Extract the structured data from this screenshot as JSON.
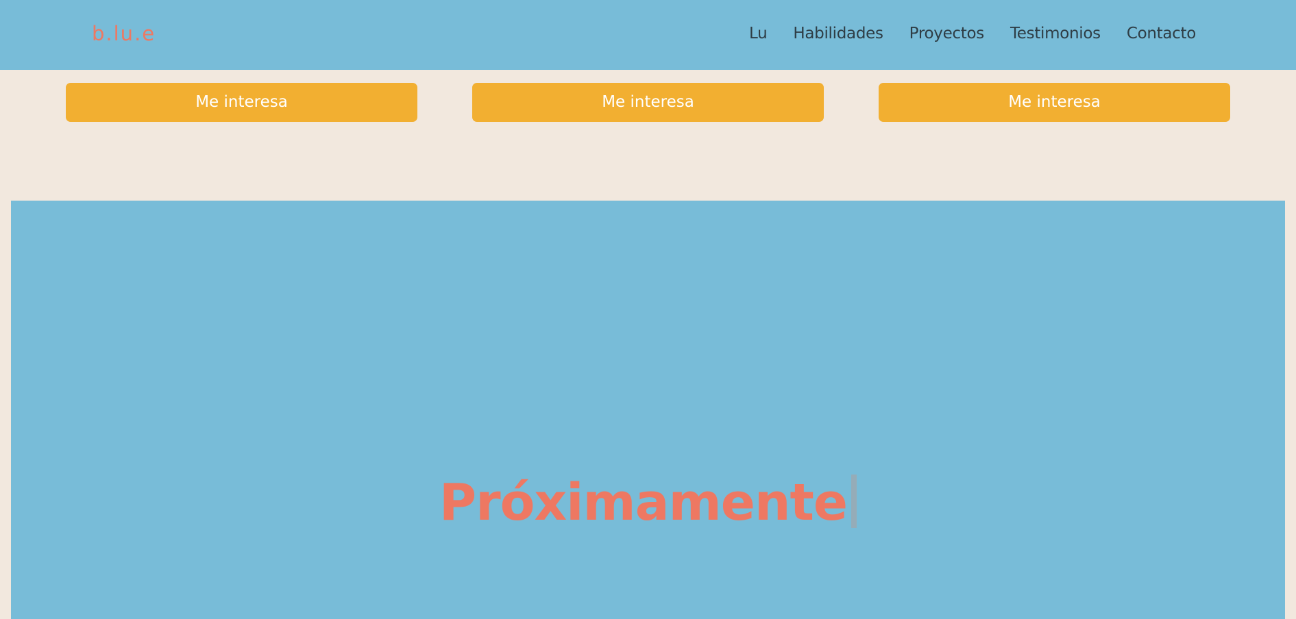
{
  "header": {
    "logo": "b.lu.e",
    "nav": [
      {
        "label": "Lu"
      },
      {
        "label": "Habilidades"
      },
      {
        "label": "Proyectos"
      },
      {
        "label": "Testimonios"
      },
      {
        "label": "Contacto"
      }
    ]
  },
  "cards": {
    "buttons": [
      {
        "label": "Me interesa"
      },
      {
        "label": "Me interesa"
      },
      {
        "label": "Me interesa"
      }
    ]
  },
  "coming_soon": {
    "title": "Próximamente"
  },
  "colors": {
    "header_bg": "#78bcd8",
    "page_bg": "#f2e8de",
    "accent": "#ee7862",
    "button_bg": "#f2af31",
    "nav_text": "#2e3d45"
  }
}
